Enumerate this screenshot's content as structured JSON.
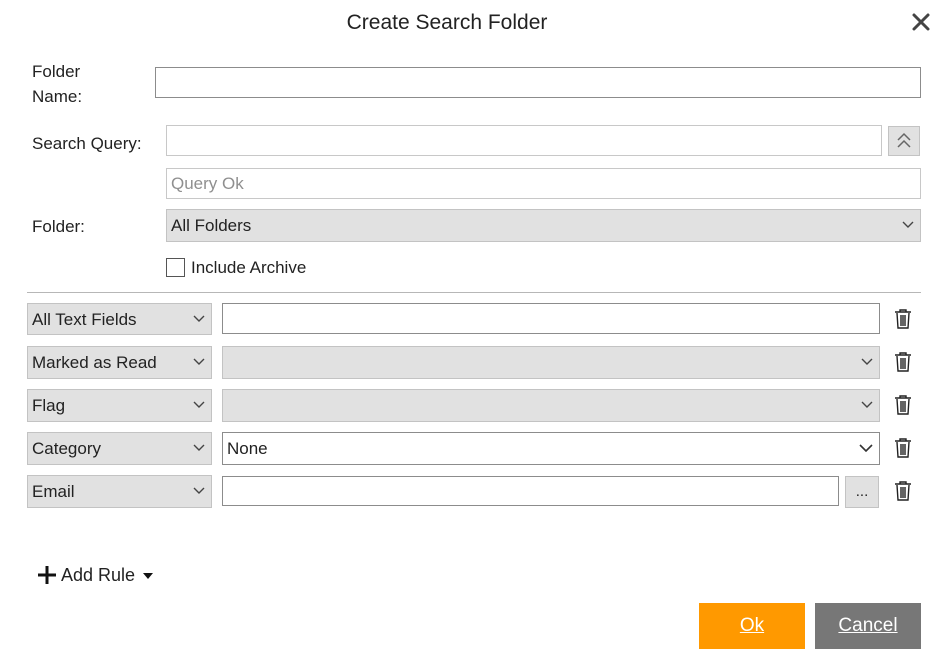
{
  "dialog": {
    "title": "Create Search Folder"
  },
  "form": {
    "folder_name_label": "Folder\nName:",
    "folder_name_value": "",
    "search_query_label": "Search Query:",
    "search_query_value": "",
    "query_status": "Query Ok",
    "folder_label": "Folder:",
    "folder_value": "All Folders",
    "include_archive_label": "Include Archive",
    "include_archive_checked": false
  },
  "rules": [
    {
      "field": "All Text Fields",
      "control": "text",
      "value": ""
    },
    {
      "field": "Marked as Read",
      "control": "select",
      "value": ""
    },
    {
      "field": "Flag",
      "control": "select",
      "value": ""
    },
    {
      "field": "Category",
      "control": "select",
      "value": "None"
    },
    {
      "field": "Email",
      "control": "text-picker",
      "value": "",
      "picker_label": "..."
    }
  ],
  "add_rule_label": "Add Rule",
  "buttons": {
    "ok": "Ok",
    "cancel": "Cancel"
  },
  "colors": {
    "ok_bg": "#ff9900",
    "cancel_bg": "#777777",
    "select_bg": "#e1e1e1"
  },
  "icons": {
    "close": "close-icon",
    "collapse": "double-chevron-up-icon",
    "dropdown": "chevron-down-icon",
    "delete": "trash-icon",
    "add": "plus-icon",
    "add_menu": "caret-down-icon"
  }
}
